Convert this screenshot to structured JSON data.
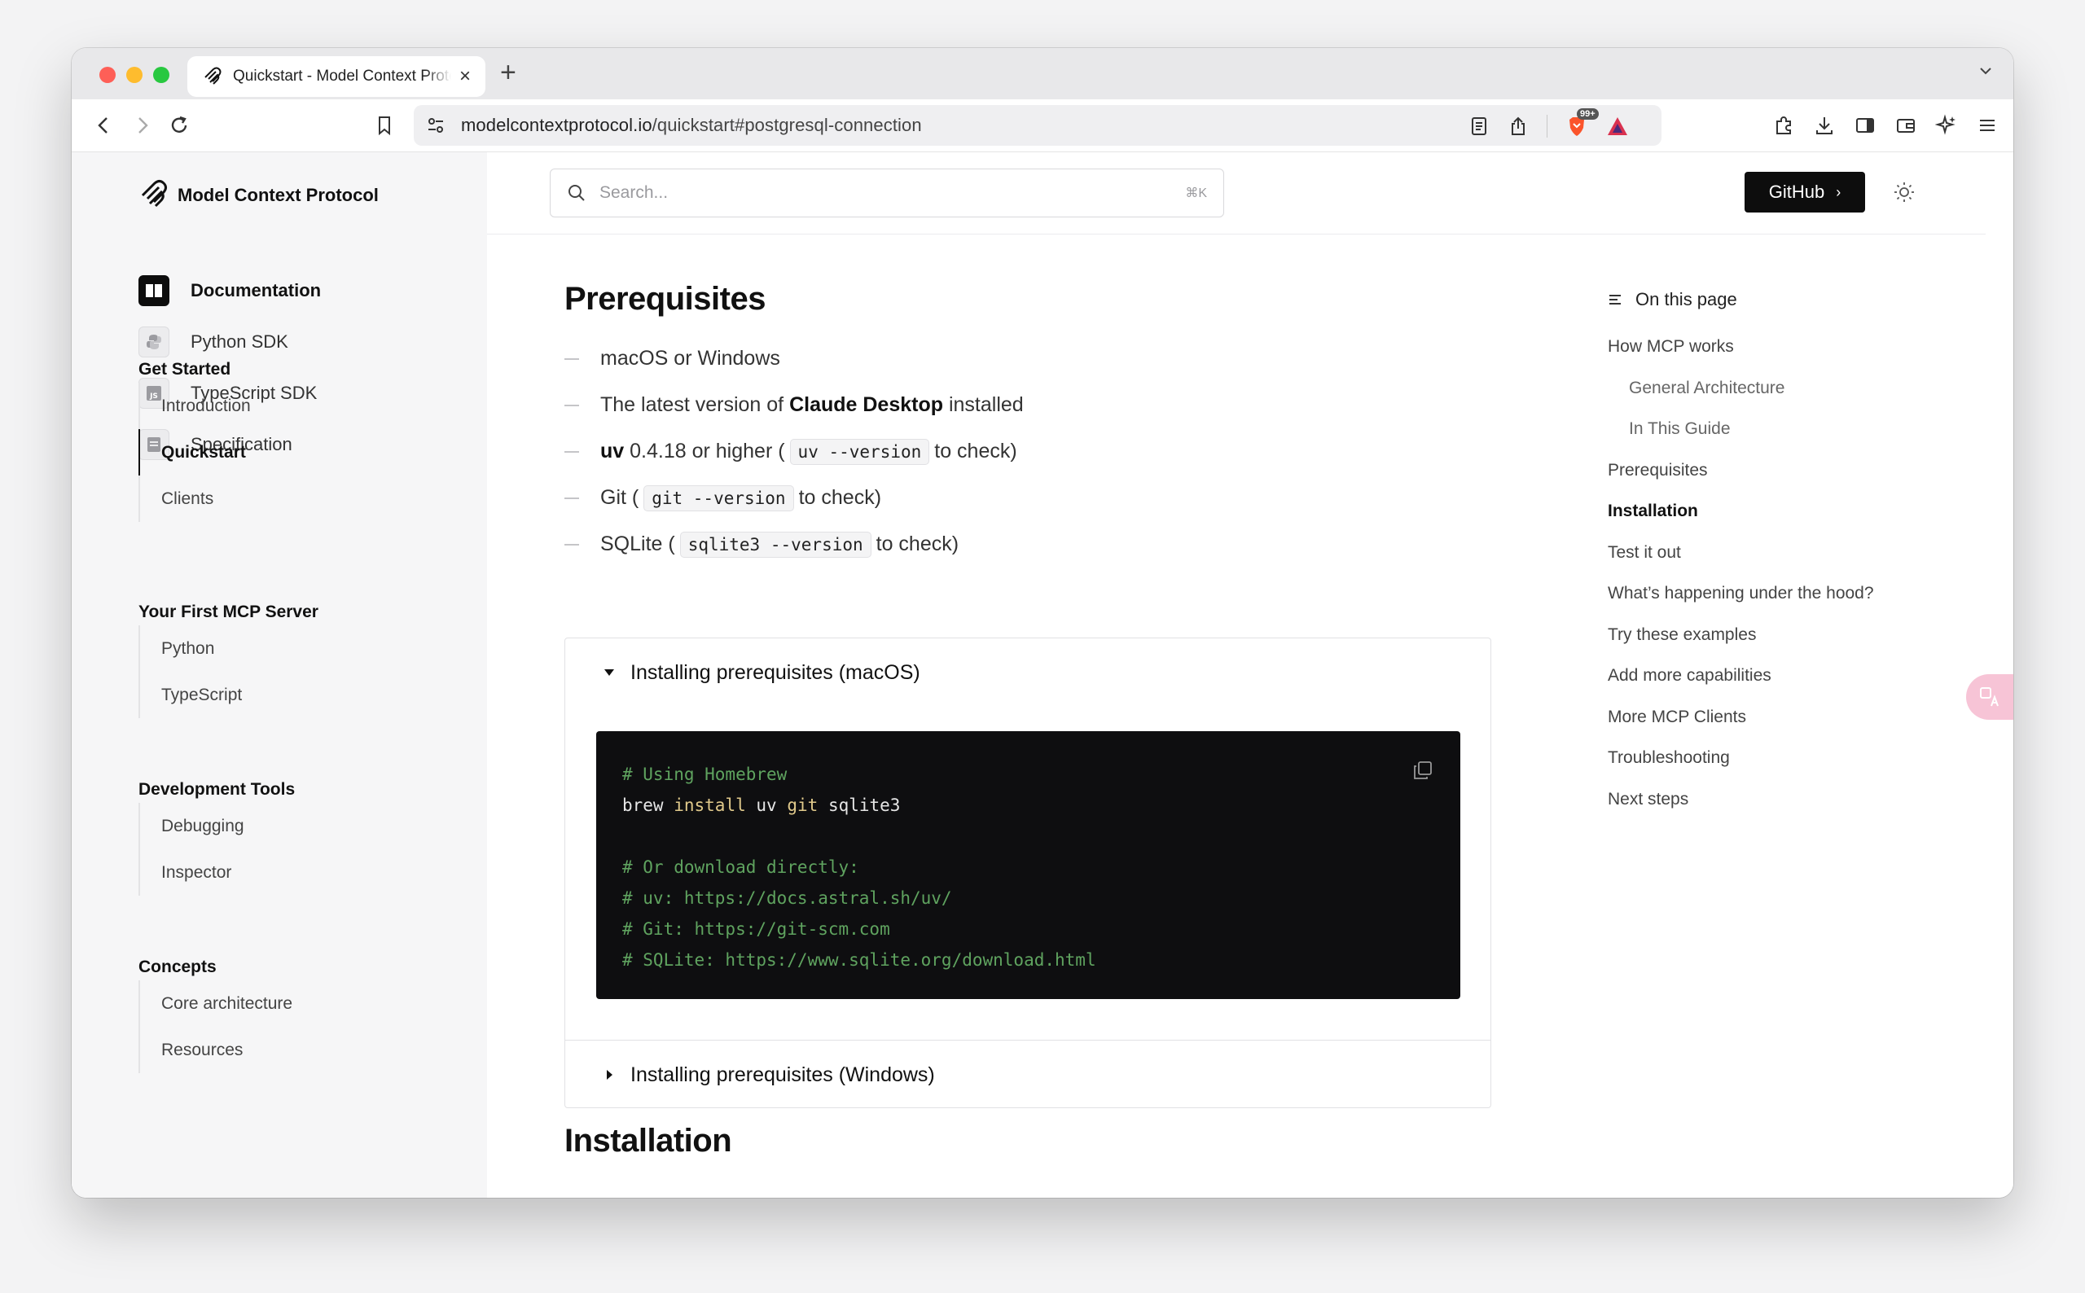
{
  "browser": {
    "tab_title": "Quickstart - Model Context Protocol",
    "url_host": "modelcontextprotocol.io",
    "url_path": "/quickstart#postgresql-connection",
    "shields_count": "99+"
  },
  "site": {
    "brand": "Model Context Protocol",
    "search_placeholder": "Search...",
    "search_shortcut": "⌘K",
    "github_label": "GitHub",
    "github_chevron": "›"
  },
  "sidebar": {
    "doc_nav": [
      {
        "label": "Documentation",
        "icon": "book-icon",
        "active": true
      },
      {
        "label": "Python SDK",
        "icon": "python-icon",
        "active": false
      },
      {
        "label": "TypeScript SDK",
        "icon": "js-icon",
        "active": false
      },
      {
        "label": "Specification",
        "icon": "spec-icon",
        "active": false
      }
    ],
    "sections": [
      {
        "title": "Get Started",
        "items": [
          "Introduction",
          "Quickstart",
          "Clients"
        ]
      },
      {
        "title": "Your First MCP Server",
        "items": [
          "Python",
          "TypeScript"
        ]
      },
      {
        "title": "Development Tools",
        "items": [
          "Debugging",
          "Inspector"
        ]
      },
      {
        "title": "Concepts",
        "items": [
          "Core architecture",
          "Resources"
        ]
      }
    ],
    "active_item": "Quickstart"
  },
  "content": {
    "prereq_heading": "Prerequisites",
    "bullets": {
      "b1": "macOS or Windows",
      "b2_pre": "The latest version of",
      "b2_bold": "Claude Desktop",
      "b2_post": "installed",
      "b3_bold": "uv",
      "b3_pre": "0.4.18 or higher (",
      "b3_code": "uv --version",
      "b3_post": "to check)",
      "b4_pre": "Git (",
      "b4_code": "git --version",
      "b4_post": "to check)",
      "b5_pre": "SQLite (",
      "b5_code": "sqlite3 --version",
      "b5_post": "to check)"
    },
    "accordion_macos": "Installing prerequisites (macOS)",
    "code": {
      "l1": "# Using Homebrew",
      "l2_cmd": "brew",
      "l2_kw1": "install",
      "l2_mid": "uv",
      "l2_kw2": "git",
      "l2_end": "sqlite3",
      "l3": "# Or download directly:",
      "l4": "# uv: https://docs.astral.sh/uv/",
      "l5": "# Git: https://git-scm.com",
      "l6": "# SQLite: https://www.sqlite.org/download.html"
    },
    "accordion_windows": "Installing prerequisites (Windows)",
    "install_heading": "Installation"
  },
  "toc": {
    "title": "On this page",
    "items": [
      {
        "label": "How MCP works",
        "level": 1
      },
      {
        "label": "General Architecture",
        "level": 2
      },
      {
        "label": "In This Guide",
        "level": 2
      },
      {
        "label": "Prerequisites",
        "level": 1
      },
      {
        "label": "Installation",
        "level": 1,
        "active": true
      },
      {
        "label": "Test it out",
        "level": 1
      },
      {
        "label": "What’s happening under the hood?",
        "level": 1
      },
      {
        "label": "Try these examples",
        "level": 1
      },
      {
        "label": "Add more capabilities",
        "level": 1
      },
      {
        "label": "More MCP Clients",
        "level": 1
      },
      {
        "label": "Troubleshooting",
        "level": 1
      },
      {
        "label": "Next steps",
        "level": 1
      }
    ]
  },
  "colors": {
    "accent": "#0d0d0d",
    "sidebar_bg": "#f6f6f7",
    "code_bg": "#0e0e10",
    "code_comment": "#5fa35f",
    "code_keyword": "#e0c98b",
    "translate_fab": "#f7c4d6"
  }
}
